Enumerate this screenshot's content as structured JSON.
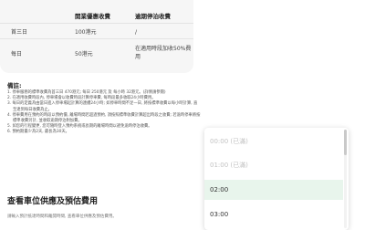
{
  "fee_table": {
    "headers": [
      "",
      "開業優惠收費",
      "逾期停泊收費"
    ],
    "rows": [
      {
        "label": "首三日",
        "promo": "100港元",
        "overdue": "/"
      },
      {
        "label": "每日",
        "promo": "50港元",
        "overdue": "在適用時段加收50%費用"
      }
    ]
  },
  "notes": {
    "title": "備註:",
    "items": [
      "1. 停車服務的標準收費為首三日 470港元; 每日 250港元 及 每小時 32港元。(詳情請參閱)",
      "2. 在適用收費時段內, 停車場會以收費時段計算停車費, 每時段最多收取24小時費用。",
      "3. 每日的定義為由當日進入停車場起計算的連續24小時; 如停車時間不足一日, 將按標準收費以每小時計算, 直至達到每日收費為止。",
      "4. 停車費用在預約的時段以預約價, 離場時間若超過預約, 須按照標準收費計算超出時段之收費; 若逾時停車將按標準收費另計, 並收取逾期停泊附加費。",
      "5. 如您的行程變更, 您可隨時登入預約系統或長期的離場時間以避免逾時停泊收費。",
      "6. 預約期最少為2天, 最長為30天。"
    ]
  },
  "section": {
    "title": "查看車位供應及預估費用",
    "subtitle": "請輸入預計抵達時間和離開時間, 查看車位供應及預估費用。"
  },
  "time_dropdown": {
    "options": [
      {
        "label": "00:00 (已滿)",
        "state": "disabled"
      },
      {
        "label": "01:00 (已滿)",
        "state": "disabled"
      },
      {
        "label": "02:00",
        "state": "selected"
      },
      {
        "label": "03:00",
        "state": "normal"
      }
    ]
  },
  "colors": {
    "selected_bg": "#e8f5ec",
    "disabled_text": "#c2c2c2",
    "card_bg": "#f6f6f6"
  }
}
